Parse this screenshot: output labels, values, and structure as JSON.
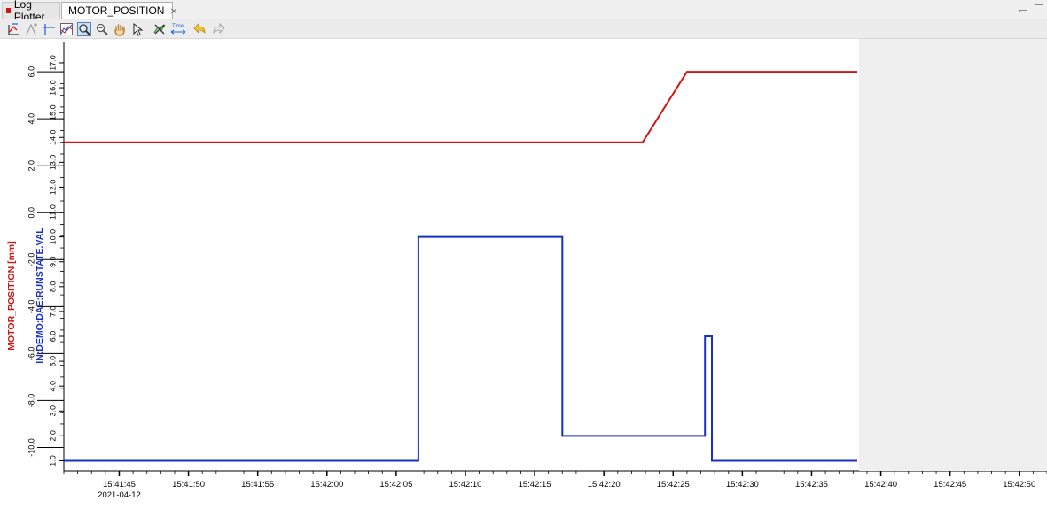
{
  "tabs": {
    "log_plotter": "Log Plotter",
    "motor_position": "MOTOR_POSITION",
    "close_symbol": "⨯"
  },
  "toolbar": {
    "icons": [
      "axis-configure-icon",
      "add-axis-icon",
      "crosshair-axis-icon",
      "stack-axes-icon",
      "rubberband-zoom-icon",
      "zoom-icon",
      "pan-icon",
      "pointer-icon",
      "remove-annotation-icon",
      "time-axis-icon",
      "undo-icon",
      "redo-icon"
    ],
    "time_label": "Time",
    "active_tool": "rubberband-zoom-icon"
  },
  "chart_data": {
    "type": "line",
    "date_label": "2021-04-12",
    "x": {
      "ticks": [
        "15:41:45",
        "15:41:50",
        "15:41:55",
        "15:42:00",
        "15:42:05",
        "15:42:10",
        "15:42:15",
        "15:42:20",
        "15:42:25",
        "15:42:30",
        "15:42:35",
        "15:42:40",
        "15:42:45",
        "15:42:50"
      ],
      "range": [
        "15:41:41",
        "15:42:52"
      ],
      "data_end": "15:42:38.3"
    },
    "axes": [
      {
        "id": "motor",
        "label": "MOTOR_POSITION [mm]",
        "color": "#d21414",
        "range": [
          -11.0,
          7.4
        ],
        "ticks": [
          6.0,
          4.0,
          2.0,
          0.0,
          -2.0,
          -4.0,
          -6.0,
          -8.0,
          -10.0
        ],
        "tick_labels": [
          "6.0",
          "4.0",
          "2.0",
          "0.0",
          "-2.0",
          "-4.0",
          "-6.0",
          "-8.0",
          "-10.0"
        ]
      },
      {
        "id": "runstate",
        "label": "IN:DEMO:DAE:RUNSTATE.VAL",
        "color": "#1a2fc8",
        "range": [
          0.59,
          17.96
        ],
        "ticks": [
          17.0,
          16.0,
          15.0,
          14.0,
          13.0,
          12.0,
          11.0,
          10.0,
          9.0,
          8.0,
          7.0,
          6.0,
          5.0,
          4.0,
          3.0,
          2.0,
          1.0
        ],
        "tick_labels": [
          "17.0",
          "16.0",
          "15.0",
          "14.0",
          "13.0",
          "12.0",
          "11.0",
          "10.0",
          "9.0",
          "8.0",
          "7.0",
          "6.0",
          "5.0",
          "4.0",
          "3.0",
          "2.0",
          "1.0"
        ]
      }
    ],
    "series": [
      {
        "name": "MOTOR_POSITION",
        "axis": "motor",
        "color": "#d21414",
        "step": false,
        "points": [
          [
            "15:41:41",
            3.0
          ],
          [
            "15:42:22.8",
            3.0
          ],
          [
            "15:42:26.0",
            6.0
          ],
          [
            "15:42:38.3",
            6.0
          ]
        ]
      },
      {
        "name": "IN:DEMO:DAE:RUNSTATE.VAL",
        "axis": "runstate",
        "color": "#1a2fc8",
        "step": true,
        "points": [
          [
            "15:41:41",
            1.0
          ],
          [
            "15:42:06.6",
            10.0
          ],
          [
            "15:42:17.0",
            2.0
          ],
          [
            "15:42:27.3",
            6.0
          ],
          [
            "15:42:27.8",
            1.0
          ],
          [
            "15:42:38.3",
            1.0
          ]
        ]
      }
    ]
  }
}
